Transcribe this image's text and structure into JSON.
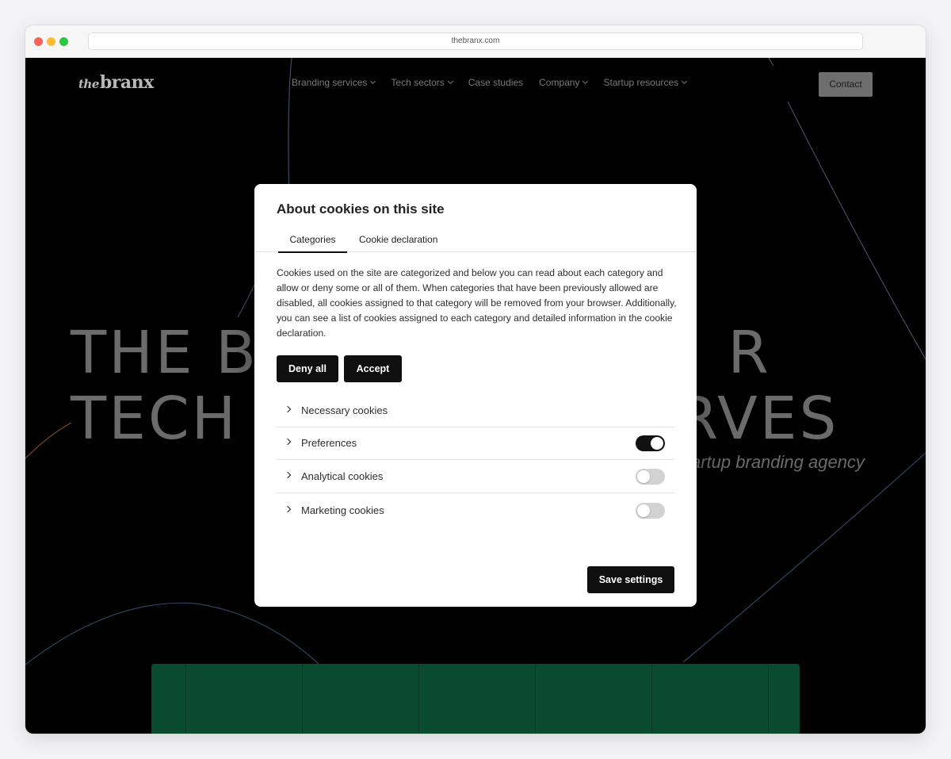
{
  "browser": {
    "url": "thebranx.com"
  },
  "site": {
    "logo": {
      "prefix": "the",
      "name": "branx"
    },
    "nav": [
      {
        "label": "Branding services",
        "dropdown": true
      },
      {
        "label": "Tech sectors",
        "dropdown": true
      },
      {
        "label": "Case studies",
        "dropdown": false
      },
      {
        "label": "Company",
        "dropdown": true
      },
      {
        "label": "Startup resources",
        "dropdown": true
      }
    ],
    "contact_label": "Contact",
    "hero": {
      "line1": "THE BR",
      "line1_end": "R",
      "line2": "TECH S",
      "line2_end": "RVES",
      "subtitle": "artup branding agency"
    }
  },
  "modal": {
    "title": "About cookies on this site",
    "tabs": [
      {
        "label": "Categories",
        "active": true
      },
      {
        "label": "Cookie declaration",
        "active": false
      }
    ],
    "description": "Cookies used on the site are categorized and below you can read about each category and allow or deny some or all of them. When categories that have been previously allowed are disabled, all cookies assigned to that category will be removed from your browser. Additionally, you can see a list of cookies assigned to each category and detailed information in the cookie declaration.",
    "deny_label": "Deny all",
    "accept_label": "Accept",
    "categories": [
      {
        "label": "Necessary cookies",
        "has_toggle": false,
        "enabled": true
      },
      {
        "label": "Preferences",
        "has_toggle": true,
        "enabled": true
      },
      {
        "label": "Analytical cookies",
        "has_toggle": true,
        "enabled": false
      },
      {
        "label": "Marketing cookies",
        "has_toggle": true,
        "enabled": false
      }
    ],
    "save_label": "Save settings"
  }
}
